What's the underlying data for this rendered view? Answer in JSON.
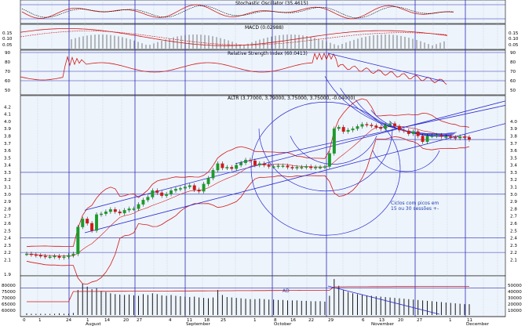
{
  "colors": {
    "background": "#ffffff",
    "plot_bg": "#eef4fb",
    "grid_major": "#2a2ab8",
    "grid_minor": "#b7c9df",
    "red": "#d01818",
    "blue": "#2a2ad0",
    "green": "#1c9a2a",
    "black": "#000000",
    "frame": "#000000"
  },
  "x_axis": {
    "tick_labels": [
      "0",
      "1",
      "24",
      "",
      "1",
      "14",
      "20",
      "27",
      "",
      "4",
      "11",
      "18",
      "25",
      "",
      "1",
      "8",
      "16",
      "22",
      "29",
      "",
      "6",
      "13",
      "20",
      "27",
      "",
      "1",
      "11"
    ],
    "month_labels": [
      "August",
      "September",
      "October",
      "November",
      "December"
    ]
  },
  "panels": {
    "stochastic": {
      "title": "Stochastic Oscillator (35.4615)"
    },
    "macd": {
      "title": "MACD (0.02988)",
      "left_ticks": [
        "0.15",
        "0.10",
        "0.05"
      ],
      "right_ticks": [
        "0.15",
        "0.10",
        "0.05"
      ]
    },
    "rsi": {
      "title": "Relative Strength Index (60.0413)",
      "left_ticks": [
        "90",
        "80",
        "70",
        "60",
        "50"
      ],
      "right_ticks": [
        "90",
        "80",
        "70",
        "60",
        "50"
      ]
    },
    "price": {
      "title": "ALTR (3.77000, 3.79000, 3.75000, 3.75000, -0.04000)",
      "left_ticks": [
        "4.2",
        "4.1",
        "4.0",
        "3.9",
        "3.8",
        "3.7",
        "3.6",
        "3.5",
        "3.4",
        "3.3",
        "3.2",
        "3.1",
        "3.0",
        "2.9",
        "2.8",
        "2.7",
        "2.6",
        "2.5",
        "2.4",
        "2.3",
        "2.2",
        "2.1",
        "1.9"
      ],
      "right_ticks": [
        "4.0",
        "3.9",
        "3.8",
        "3.7",
        "3.6",
        "3.5",
        "3.4",
        "3.3",
        "3.2",
        "3.1",
        "3.0",
        "2.9",
        "2.8",
        "2.7",
        "2.6",
        "2.5",
        "2.4",
        "2.3",
        "2.2",
        "2.1"
      ],
      "note_lines": [
        "Ciclos com picos em",
        "15 ou 30 sessões +-"
      ]
    },
    "volume": {
      "ad_label": "AD",
      "left_ticks": [
        "80000",
        "75000",
        "70000",
        "65000",
        "60000"
      ],
      "right_ticks": [
        "50000",
        "40000",
        "30000",
        "20000",
        "10000"
      ]
    }
  },
  "chart_data": {
    "type": "candlestick",
    "symbol": "ALTR",
    "last": {
      "open": 3.77,
      "high": 3.79,
      "low": 3.75,
      "close": 3.75,
      "change": -0.04
    },
    "indicators": {
      "stochastic": 35.4615,
      "macd": 0.02988,
      "rsi": 60.0413
    },
    "price_range": [
      1.9,
      4.3
    ],
    "closes": [
      2.18,
      2.17,
      2.16,
      2.15,
      2.14,
      2.14,
      2.15,
      2.13,
      2.14,
      2.16,
      2.18,
      2.55,
      2.66,
      2.6,
      2.5,
      2.72,
      2.73,
      2.76,
      2.79,
      2.76,
      2.74,
      2.78,
      2.8,
      2.8,
      2.86,
      2.92,
      2.96,
      3.05,
      3.02,
      2.98,
      3.0,
      3.05,
      3.07,
      3.08,
      3.1,
      3.12,
      3.06,
      3.04,
      3.14,
      3.22,
      3.33,
      3.42,
      3.36,
      3.37,
      3.35,
      3.4,
      3.43,
      3.47,
      3.46,
      3.4,
      3.42,
      3.4,
      3.38,
      3.38,
      3.39,
      3.39,
      3.37,
      3.36,
      3.37,
      3.37,
      3.38,
      3.36,
      3.37,
      3.37,
      3.38,
      3.56,
      3.9,
      3.92,
      3.86,
      3.88,
      3.9,
      3.93,
      3.96,
      3.95,
      3.94,
      3.92,
      3.9,
      3.95,
      3.97,
      3.93,
      3.88,
      3.87,
      3.83,
      3.86,
      3.8,
      3.72,
      3.8,
      3.8,
      3.81,
      3.79,
      3.79,
      3.78,
      3.77,
      3.79,
      3.78,
      3.75
    ],
    "volume_range": [
      60000,
      90000
    ],
    "volumes": [
      4000,
      3000,
      2500,
      3000,
      2000,
      2500,
      3000,
      4000,
      3000,
      2500,
      5000,
      60000,
      75000,
      68000,
      62000,
      64000,
      58000,
      55000,
      52000,
      50000,
      49000,
      48000,
      49000,
      47000,
      46000,
      50000,
      48000,
      52000,
      50000,
      47000,
      46000,
      48000,
      46000,
      45000,
      44000,
      43000,
      44000,
      42000,
      41000,
      40000,
      42000,
      60000,
      48000,
      43000,
      42000,
      41000,
      40000,
      39000,
      38000,
      38000,
      39000,
      38000,
      37000,
      37000,
      36000,
      36000,
      35000,
      35000,
      35000,
      34000,
      34000,
      33000,
      33000,
      33000,
      32000,
      46000,
      86000,
      70000,
      60000,
      55000,
      52000,
      50000,
      48000,
      47000,
      46000,
      45000,
      44000,
      43000,
      42000,
      41000,
      40000,
      39000,
      38000,
      37000,
      36000,
      35000,
      34000,
      33000,
      32000,
      31000,
      30000,
      29000,
      28000,
      27000,
      26000,
      26000
    ]
  }
}
